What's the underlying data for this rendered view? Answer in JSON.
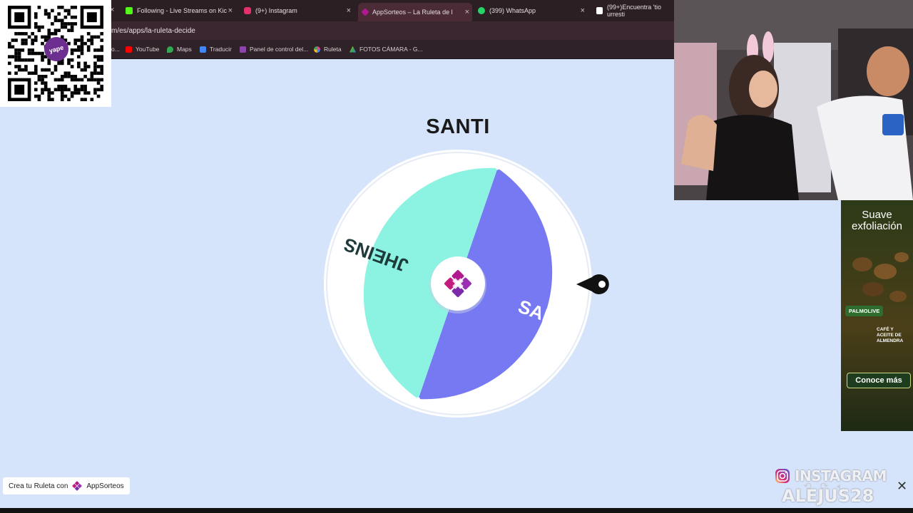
{
  "tabs": [
    {
      "label": "Following - Live Streams on Kic",
      "icon": "kick-icon",
      "color": "#53fc18"
    },
    {
      "label": "(9+) Instagram",
      "icon": "instagram-icon",
      "color": "#e1306c"
    },
    {
      "label": "AppSorteos – La Ruleta de l",
      "icon": "appsorteos-icon",
      "color": "#b0198f",
      "active": true
    },
    {
      "label": "(399) WhatsApp",
      "icon": "whatsapp-icon",
      "color": "#25d366"
    },
    {
      "label": "(99+)Encuentra 'tio urresti",
      "icon": "tiktok-icon",
      "color": "#ffffff"
    }
  ],
  "address": {
    "url": "m/es/apps/la-ruleta-decide"
  },
  "bookmarks": [
    {
      "label": "YouTube",
      "color": "#ff0000"
    },
    {
      "label": "Maps",
      "color": "#34a853"
    },
    {
      "label": "Traducir",
      "color": "#4285f4"
    },
    {
      "label": "Panel de control del...",
      "color": "#8e44ad"
    },
    {
      "label": "Ruleta",
      "color": "#e84393"
    },
    {
      "label": "FOTOS CÁMARA - G...",
      "color": "#fbbc05"
    }
  ],
  "qr": {
    "brand": "yape"
  },
  "roulette": {
    "result": "SANTI",
    "segments": [
      {
        "label": "JHEINS",
        "color": "#8cf2e2"
      },
      {
        "label": "SANTI",
        "color": "#7679f2"
      }
    ]
  },
  "ad": {
    "headline_1": "Suave",
    "headline_2": "exfoliación",
    "brand": "PALMOLIVE",
    "product": "CAFÉ Y ACEITE DE ALMENDRA",
    "cta": "Conoce más"
  },
  "footer": {
    "crea_label": "Crea tu Ruleta con",
    "app_name": "AppSorteos"
  },
  "overlay": {
    "instagram_label": "INSTAGRAM",
    "username": "ALEJUS28"
  }
}
